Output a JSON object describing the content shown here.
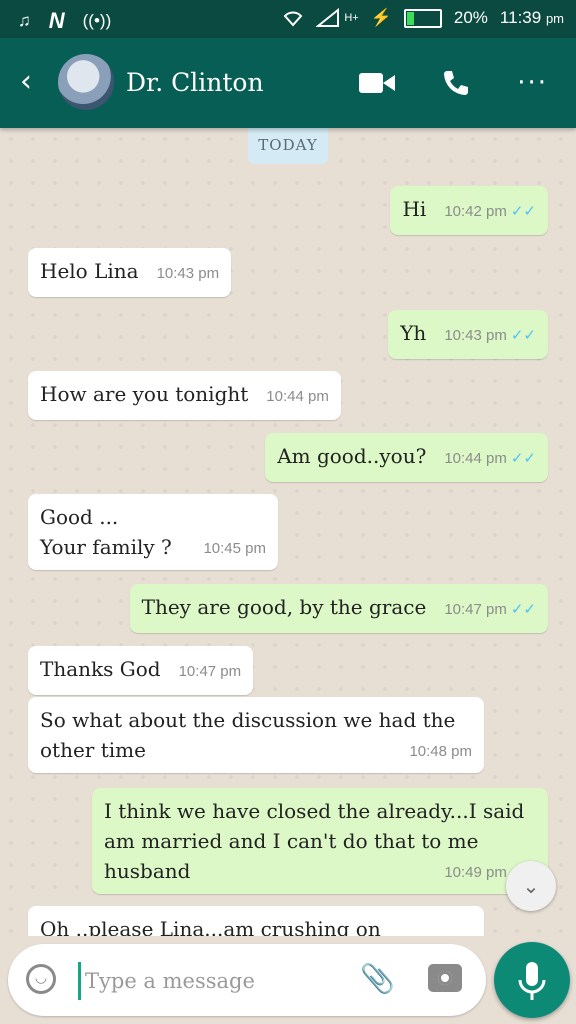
{
  "status": {
    "battery": "20%",
    "time": "11:39",
    "time_suffix": "pm",
    "network": "H+"
  },
  "header": {
    "contact_name": "Dr. Clinton"
  },
  "chat": {
    "date_label": "TODAY",
    "messages": [
      {
        "dir": "out",
        "text": "Hi",
        "time": "10:42 pm"
      },
      {
        "dir": "in",
        "text": "Helo Lina",
        "time": "10:43 pm"
      },
      {
        "dir": "out",
        "text": "Yh",
        "time": "10:43 pm"
      },
      {
        "dir": "in",
        "text": "How are you tonight",
        "time": "10:44 pm"
      },
      {
        "dir": "out",
        "text": "Am good..you?",
        "time": "10:44 pm"
      },
      {
        "dir": "in",
        "line1": "Good ...",
        "line2": "Your family ?",
        "time": "10:45 pm"
      },
      {
        "dir": "out",
        "text": "They are good, by the grace",
        "time": "10:47 pm"
      },
      {
        "dir": "in",
        "text": "Thanks God",
        "time": "10:47 pm"
      },
      {
        "dir": "in",
        "line1": "So what about the discussion we had the",
        "line2": "other time",
        "time": "10:48 pm"
      },
      {
        "dir": "out",
        "line1": "I think we have closed the already...I said",
        "line2": "am married and I can't do that to me",
        "line3": "husband",
        "time": "10:49 pm"
      },
      {
        "dir": "in",
        "text": "Oh ..please Lina...am crushing on you...Yet"
      }
    ]
  },
  "composer": {
    "placeholder": "Type a message"
  },
  "colors": {
    "header": "#075e54",
    "status_bar": "#0b4a40",
    "outgoing_bubble": "#dcf8c6",
    "incoming_bubble": "#ffffff",
    "read_ticks": "#4fc3f7",
    "mic_button": "#0d8a76"
  },
  "icons": [
    "music-icon",
    "n-app-icon",
    "hotspot-icon",
    "wifi-icon",
    "signal-icon",
    "flash-icon",
    "battery-icon",
    "back-arrow-icon",
    "video-call-icon",
    "voice-call-icon",
    "more-icon",
    "double-check-icon",
    "chevron-down-icon",
    "emoji-icon",
    "attach-icon",
    "camera-icon",
    "mic-icon"
  ]
}
